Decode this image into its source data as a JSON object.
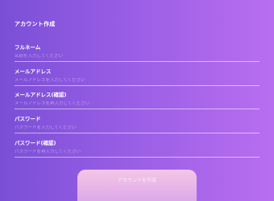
{
  "form": {
    "title": "アカウント作成",
    "fields": [
      {
        "label": "フルネーム",
        "placeholder": "名前を入力してください"
      },
      {
        "label": "メールアドレス",
        "placeholder": "メールアドレスを入力してください"
      },
      {
        "label": "メールアドレス(確認)",
        "placeholder": "メールアドレスを再入力してください"
      },
      {
        "label": "パスワード",
        "placeholder": "パスワードを入力してください"
      },
      {
        "label": "パスワード(確認)",
        "placeholder": "パスワードを再入力してください"
      }
    ],
    "submit_label": "アカウントを作成"
  },
  "colors": {
    "background_start": "#7a4fd6",
    "background_end": "#b96ef0",
    "button_top": "#f4c6e6",
    "button_bottom": "#d7a2ea"
  }
}
